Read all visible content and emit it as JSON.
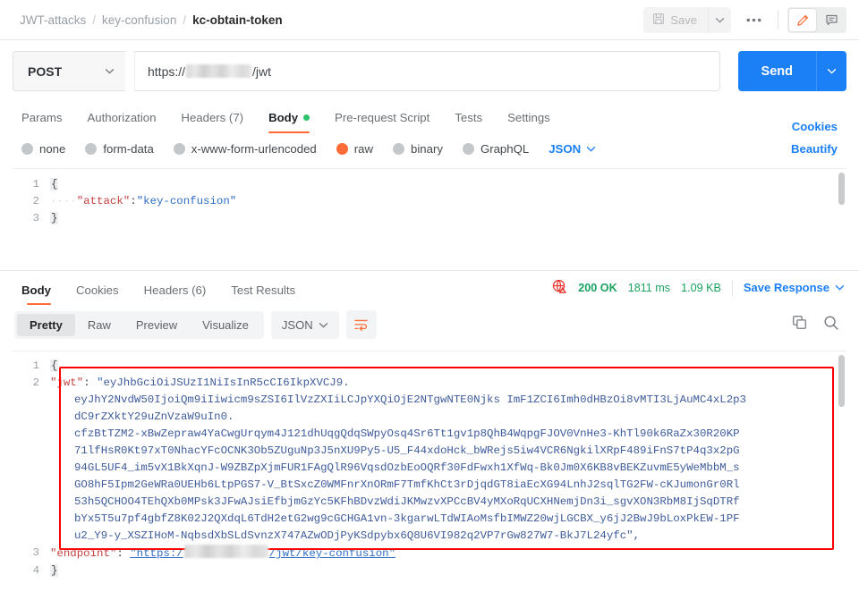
{
  "breadcrumb": {
    "items": [
      "JWT-attacks",
      "key-confusion"
    ],
    "separator": "/",
    "current": "kc-obtain-token"
  },
  "topbar": {
    "save_label": "Save",
    "save_caret": "⌄",
    "more_label": "●●●",
    "edit_icon": "pencil-icon",
    "comment_icon": "comment-icon"
  },
  "request": {
    "method": "POST",
    "method_caret": "⌄",
    "url_prefix": "https://",
    "url_suffix": "/jwt",
    "send_label": "Send",
    "send_caret": "⌄",
    "tabs": [
      {
        "label": "Params",
        "active": false
      },
      {
        "label": "Authorization",
        "active": false
      },
      {
        "label": "Headers (7)",
        "active": false
      },
      {
        "label": "Body",
        "active": true,
        "dot": true
      },
      {
        "label": "Pre-request Script",
        "active": false
      },
      {
        "label": "Tests",
        "active": false
      },
      {
        "label": "Settings",
        "active": false
      }
    ],
    "cookies_link": "Cookies",
    "body_types": [
      {
        "label": "none",
        "selected": false
      },
      {
        "label": "form-data",
        "selected": false
      },
      {
        "label": "x-www-form-urlencoded",
        "selected": false
      },
      {
        "label": "raw",
        "selected": true
      },
      {
        "label": "binary",
        "selected": false
      },
      {
        "label": "GraphQL",
        "selected": false
      }
    ],
    "format": "JSON",
    "format_caret": "⌄",
    "beautify_link": "Beautify",
    "body_lines": [
      {
        "no": "1",
        "brace": "{"
      },
      {
        "no": "2",
        "indent": "····",
        "key": "\"attack\"",
        "colon": ":",
        "value": "\"key-confusion\""
      },
      {
        "no": "3",
        "brace": "}"
      }
    ]
  },
  "response": {
    "tabs": [
      {
        "label": "Body",
        "active": true
      },
      {
        "label": "Cookies",
        "active": false
      },
      {
        "label": "Headers (6)",
        "active": false
      },
      {
        "label": "Test Results",
        "active": false
      }
    ],
    "headers_count_color": "#1aa260",
    "warn_icon": "globe-warning-icon",
    "status": "200 OK",
    "time": "1811 ms",
    "size": "1.09 KB",
    "save_response": "Save Response",
    "save_response_caret": "⌄",
    "view_modes": [
      {
        "label": "Pretty",
        "active": true
      },
      {
        "label": "Raw",
        "active": false
      },
      {
        "label": "Preview",
        "active": false
      },
      {
        "label": "Visualize",
        "active": false
      }
    ],
    "format": "JSON",
    "format_caret": "⌄",
    "wrap_icon": "wrap-lines-icon",
    "copy_icon": "copy-icon",
    "search_icon": "search-icon",
    "highlight_color": "#ff0000",
    "body_lines": [
      {
        "no": "1",
        "brace": "{"
      },
      {
        "no": "2",
        "key": "\"jwt\"",
        "colon": ": ",
        "value_open": "\""
      },
      {
        "no": "3",
        "key": "\"endpoint\"",
        "colon": ": ",
        "url_prefix": "\"https:/",
        "url_suffix": "/jwt/key-confusion\""
      },
      {
        "no": "4",
        "brace": "}"
      }
    ],
    "jwt_segments": [
      "eyJhbGciOiJSUzI1NiIsInR5cCI6IkpXVCJ9.",
      "eyJhY2NvdW50IjoiQm9iIiwicm9sZSI6IlVzZXIiLCJpYXQiOjE2NTgwNTE0Njks ImF1ZCI6Imh0dHBzOi8vMTI3LjAuMC4xL2p3",
      "dC9rZXktY29uZnVzaW9uIn0.",
      "cfzBtTZM2-xBwZepraw4YaCwgUrqym4J121dhUqgQdqSWpyOsq4Sr6Tt1gv1p8QhB4WqpgFJOV0VnHe3-KhTl90k6RaZx30R20KP",
      "71lfHsR0Kt97xT0NhacYFcOCNK3Ob5ZUguNp3J5nXU9Py5-U5_F44xdoHck_bWRejs5iw4VCR6NgkilXRpF489iFnS7tP4q3x2pG",
      "94GL5UF4_im5vX1BkXqnJ-W9ZBZpXjmFUR1FAgQlR96VqsdOzbEoOQRf30FdFwxh1XfWq-Bk0Jm0X6KB8vBEKZuvmE5yWeMbbM_s",
      "GO8hF5Ipm2GeWRa0UEHb6LtpPGS7-V_BtSxcZ0WMFnrXnORmF7TmfKhCt3rDjqdGT8iaEcXG94LnhJ2sqlTG2FW-cKJumonGr0Rl",
      "53h5QCHOO4TEhQXb0MPsk3JFwAJsiEfbjmGzYc5KFhBDvzWdiJKMwzvXPCcBV4yMXoRqUCXHNemjDn3i_sgvXON3RbM8IjSqDTRf",
      "bYx5T5u7pf4gbfZ8K02J2QXdqL6TdH2etG2wg9cGCHGA1vn-3kgarwLTdWIAoMsfbIMWZ20wjLGCBX_y6jJ2BwJ9bLoxPkEW-1PF",
      "u2_Y9-y_XSZIHoM-NqbsdXbSLdSvnzX747AZwODjPyKSdpybx6Q8U6VI982q2VP7rGw827W7-BkJ7L24yfc\","
    ]
  }
}
